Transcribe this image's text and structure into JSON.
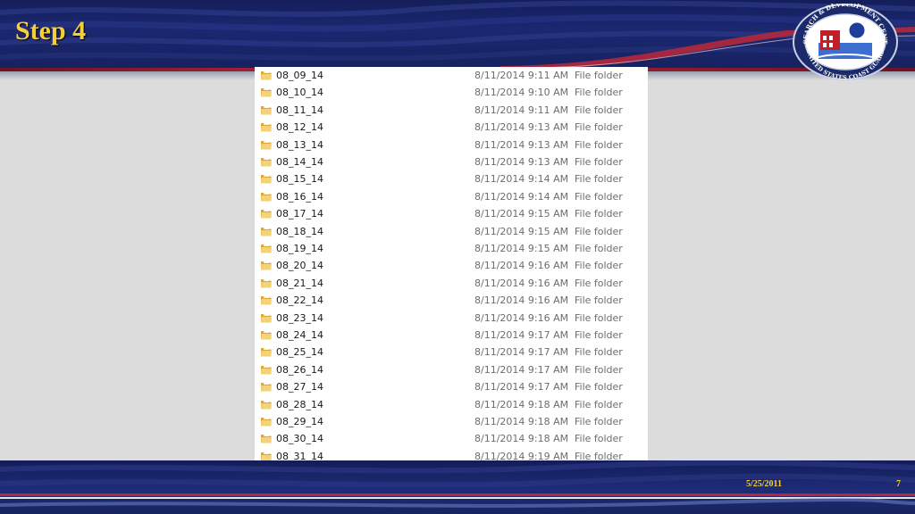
{
  "slide": {
    "title": "Step 4",
    "date": "5/25/2011",
    "page_number": "7"
  },
  "seal": {
    "top_text": "RESEARCH & DEVELOPMENT CENTER",
    "bottom_text": "UNITED STATES COAST GUARD"
  },
  "colors": {
    "title": "#f4cf3a",
    "header_bg": "#1b2870",
    "accent_red": "#b4283c",
    "folder_yellow": "#e9c15a"
  },
  "file_list": {
    "icon": "folder-icon",
    "items": [
      {
        "name": "08_09_14",
        "date": "8/11/2014 9:11 AM",
        "type": "File folder"
      },
      {
        "name": "08_10_14",
        "date": "8/11/2014 9:10 AM",
        "type": "File folder"
      },
      {
        "name": "08_11_14",
        "date": "8/11/2014 9:11 AM",
        "type": "File folder"
      },
      {
        "name": "08_12_14",
        "date": "8/11/2014 9:13 AM",
        "type": "File folder"
      },
      {
        "name": "08_13_14",
        "date": "8/11/2014 9:13 AM",
        "type": "File folder"
      },
      {
        "name": "08_14_14",
        "date": "8/11/2014 9:13 AM",
        "type": "File folder"
      },
      {
        "name": "08_15_14",
        "date": "8/11/2014 9:14 AM",
        "type": "File folder"
      },
      {
        "name": "08_16_14",
        "date": "8/11/2014 9:14 AM",
        "type": "File folder"
      },
      {
        "name": "08_17_14",
        "date": "8/11/2014 9:15 AM",
        "type": "File folder"
      },
      {
        "name": "08_18_14",
        "date": "8/11/2014 9:15 AM",
        "type": "File folder"
      },
      {
        "name": "08_19_14",
        "date": "8/11/2014 9:15 AM",
        "type": "File folder"
      },
      {
        "name": "08_20_14",
        "date": "8/11/2014 9:16 AM",
        "type": "File folder"
      },
      {
        "name": "08_21_14",
        "date": "8/11/2014 9:16 AM",
        "type": "File folder"
      },
      {
        "name": "08_22_14",
        "date": "8/11/2014 9:16 AM",
        "type": "File folder"
      },
      {
        "name": "08_23_14",
        "date": "8/11/2014 9:16 AM",
        "type": "File folder"
      },
      {
        "name": "08_24_14",
        "date": "8/11/2014 9:17 AM",
        "type": "File folder"
      },
      {
        "name": "08_25_14",
        "date": "8/11/2014 9:17 AM",
        "type": "File folder"
      },
      {
        "name": "08_26_14",
        "date": "8/11/2014 9:17 AM",
        "type": "File folder"
      },
      {
        "name": "08_27_14",
        "date": "8/11/2014 9:17 AM",
        "type": "File folder"
      },
      {
        "name": "08_28_14",
        "date": "8/11/2014 9:18 AM",
        "type": "File folder"
      },
      {
        "name": "08_29_14",
        "date": "8/11/2014 9:18 AM",
        "type": "File folder"
      },
      {
        "name": "08_30_14",
        "date": "8/11/2014 9:18 AM",
        "type": "File folder"
      },
      {
        "name": "08_31_14",
        "date": "8/11/2014 9:19 AM",
        "type": "File folder"
      }
    ]
  }
}
